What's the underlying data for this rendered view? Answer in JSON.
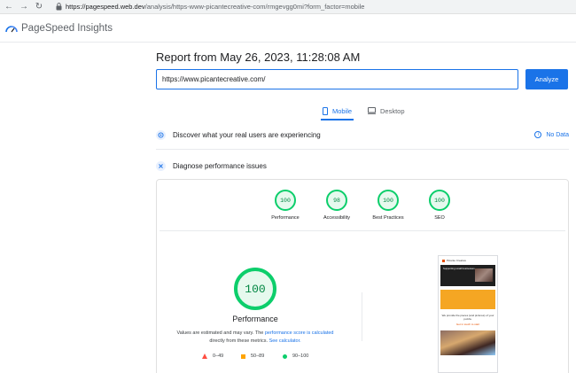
{
  "browser": {
    "url_domain": "https://pagespeed.web.dev",
    "url_path": "/analysis/https-www-picantecreative-com/rmgevgg0mi?form_factor=mobile"
  },
  "header": {
    "brand": "PageSpeed Insights"
  },
  "report": {
    "title": "Report from May 26, 2023, 11:28:08 AM",
    "url_value": "https://www.picantecreative.com/",
    "analyze_label": "Analyze"
  },
  "tabs": {
    "mobile": "Mobile",
    "desktop": "Desktop"
  },
  "sections": {
    "real_users": "Discover what your real users are experiencing",
    "no_data": "No Data",
    "diagnose": "Diagnose performance issues"
  },
  "scores": [
    {
      "label": "Performance",
      "value": "100"
    },
    {
      "label": "Accessibility",
      "value": "98"
    },
    {
      "label": "Best Practices",
      "value": "100"
    },
    {
      "label": "SEO",
      "value": "100"
    }
  ],
  "performance": {
    "score": "100",
    "label": "Performance",
    "note_1": "Values are estimated and may vary. The ",
    "note_link_1": "performance score is calculated",
    "note_2": "directly from these metrics. ",
    "note_link_2": "See calculator."
  },
  "legend": {
    "fail": "0–49",
    "average": "50–89",
    "pass": "90–100"
  },
  "phone": {
    "brand": "Picante Creative",
    "hero_text": "Supporting small businesses",
    "body_text": "We provide the pieces (and pictures) of your puzzle.",
    "link_text": "Get in touch to start"
  },
  "colors": {
    "accent": "#1a73e8",
    "pass": "#0cce6b",
    "average": "#ffa400",
    "fail": "#ff4e42"
  }
}
